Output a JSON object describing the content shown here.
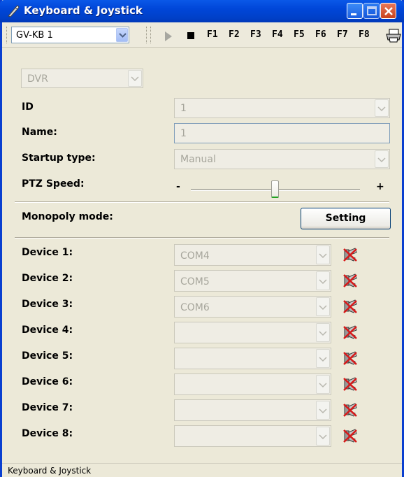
{
  "window": {
    "title": "Keyboard & Joystick"
  },
  "toolbar": {
    "selector_value": "GV-KB 1",
    "fkeys": [
      "F1",
      "F2",
      "F3",
      "F4",
      "F5",
      "F6",
      "F7",
      "F8"
    ]
  },
  "panel": {
    "type_value": "DVR",
    "id_label": "ID",
    "id_value": "1",
    "name_label": "Name:",
    "name_value": "1",
    "startup_label": "Startup type:",
    "startup_value": "Manual",
    "ptz_label": "PTZ Speed:",
    "ptz_minus": "-",
    "ptz_plus": "+",
    "ptz_level": 0.5,
    "monopoly_label": "Monopoly mode:",
    "setting_button": "Setting",
    "devices": [
      {
        "label": "Device 1:",
        "value": "COM4"
      },
      {
        "label": "Device 2:",
        "value": "COM5"
      },
      {
        "label": "Device 3:",
        "value": "COM6"
      },
      {
        "label": "Device 4:",
        "value": ""
      },
      {
        "label": "Device 5:",
        "value": ""
      },
      {
        "label": "Device 6:",
        "value": ""
      },
      {
        "label": "Device 7:",
        "value": ""
      },
      {
        "label": "Device 8:",
        "value": ""
      }
    ]
  },
  "status_bar": {
    "text": "Keyboard & Joystick"
  },
  "colors": {
    "titlebar": "#0046D8",
    "face": "#ECE9D8",
    "close": "#C8421C"
  }
}
